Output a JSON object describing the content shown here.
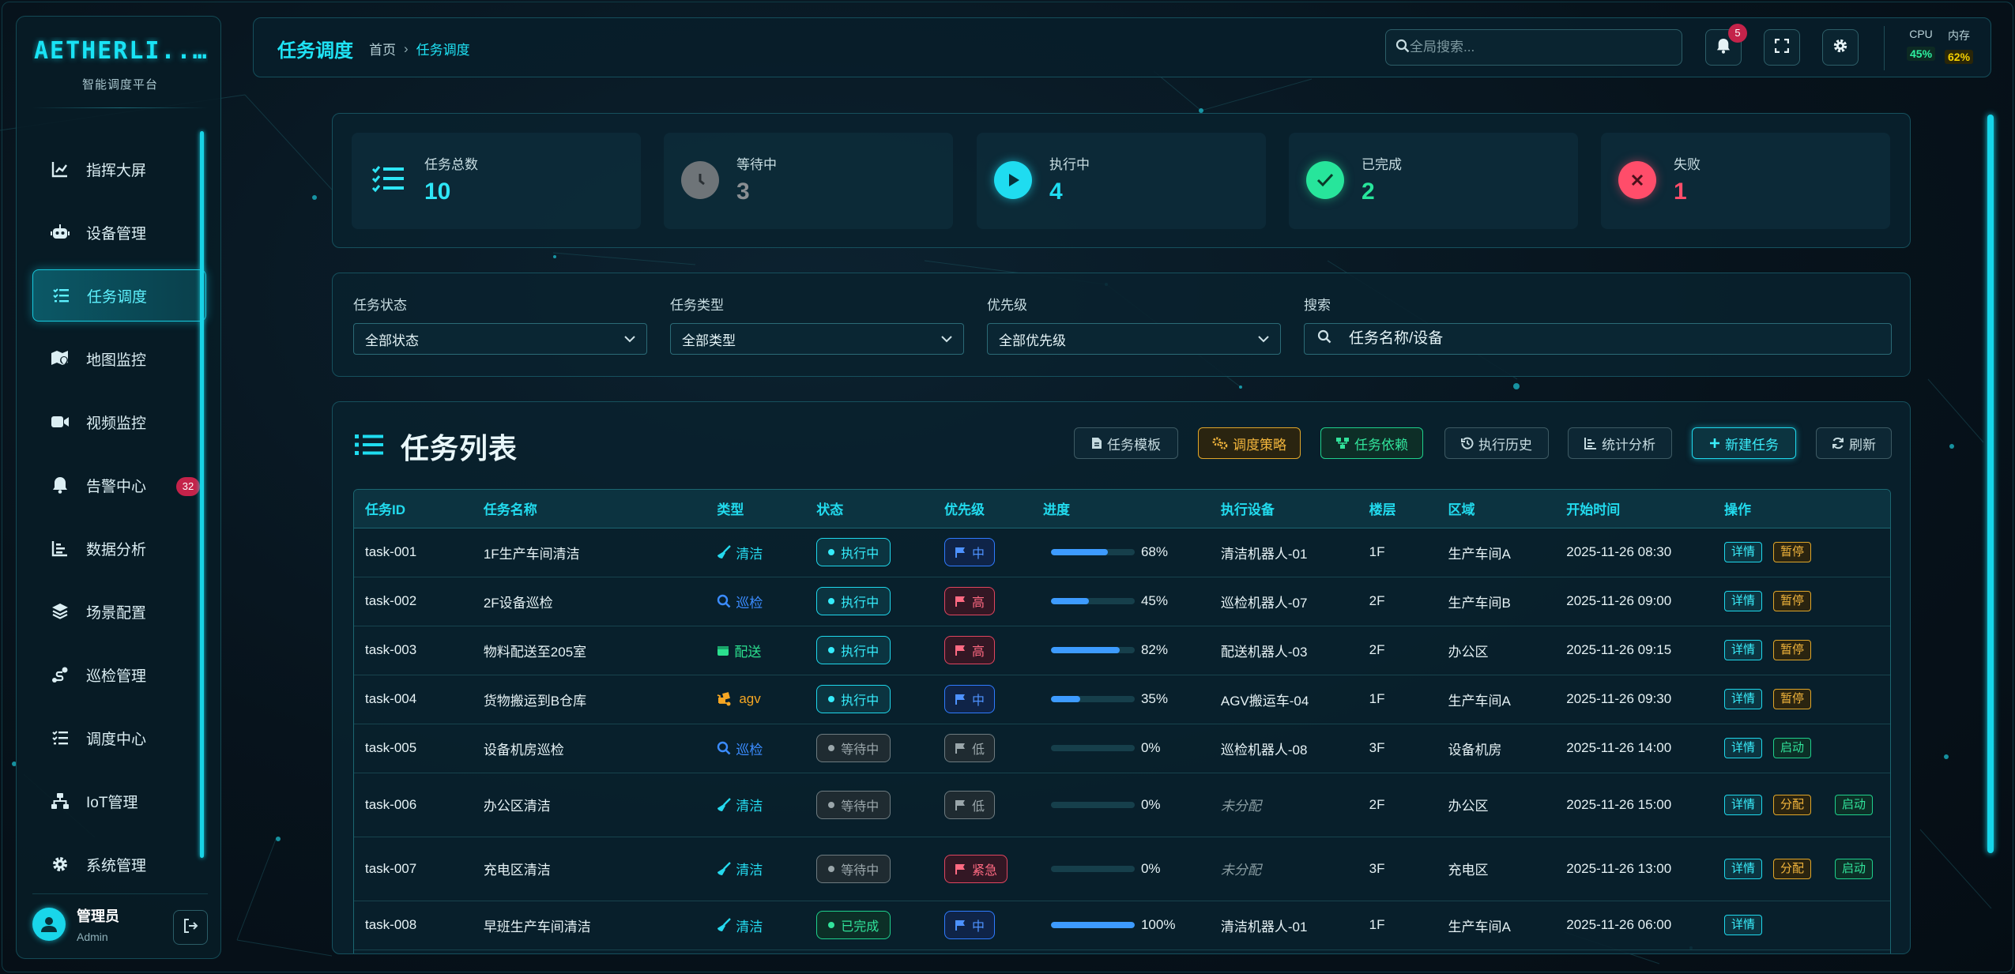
{
  "brand": {
    "logo": "AETHERLI...",
    "subtitle": "智能调度平台"
  },
  "sidebar": {
    "items": [
      {
        "label": "指挥大屏",
        "icon": "chart-line-icon"
      },
      {
        "label": "设备管理",
        "icon": "robot-icon"
      },
      {
        "label": "任务调度",
        "icon": "task-list-icon",
        "active": true
      },
      {
        "label": "地图监控",
        "icon": "map-marker-icon"
      },
      {
        "label": "视频监控",
        "icon": "video-icon"
      },
      {
        "label": "告警中心",
        "icon": "bell-icon",
        "badge": "32"
      },
      {
        "label": "数据分析",
        "icon": "bar-chart-icon"
      },
      {
        "label": "场景配置",
        "icon": "layers-icon"
      },
      {
        "label": "巡检管理",
        "icon": "route-icon"
      },
      {
        "label": "调度中心",
        "icon": "checklist-icon"
      },
      {
        "label": "IoT管理",
        "icon": "network-icon"
      },
      {
        "label": "系统管理",
        "icon": "gear-icon"
      }
    ],
    "user": {
      "name": "管理员",
      "role": "Admin"
    }
  },
  "header": {
    "title": "任务调度",
    "breadcrumb": {
      "home": "首页",
      "current": "任务调度"
    },
    "search_placeholder": "全局搜索...",
    "notification_count": "5",
    "metrics": {
      "cpu_label": "CPU",
      "cpu_value": "45%",
      "mem_label": "内存",
      "mem_value": "62%"
    }
  },
  "stats": [
    {
      "label": "任务总数",
      "value": "10",
      "color": "#2ee6f6"
    },
    {
      "label": "等待中",
      "value": "3",
      "color": "#8a8f93"
    },
    {
      "label": "执行中",
      "value": "4",
      "color": "#1fdcf0"
    },
    {
      "label": "已完成",
      "value": "2",
      "color": "#27e59b"
    },
    {
      "label": "失败",
      "value": "1",
      "color": "#ff4d6a"
    }
  ],
  "filters": {
    "status": {
      "label": "任务状态",
      "value": "全部状态"
    },
    "type": {
      "label": "任务类型",
      "value": "全部类型"
    },
    "priority": {
      "label": "优先级",
      "value": "全部优先级"
    },
    "search": {
      "label": "搜索",
      "placeholder": "任务名称/设备"
    }
  },
  "tasks": {
    "title": "任务列表",
    "toolbar": {
      "template": "任务模板",
      "strategy": "调度策略",
      "dependency": "任务依赖",
      "history": "执行历史",
      "stats": "统计分析",
      "new": "新建任务",
      "refresh": "刷新"
    },
    "columns": [
      "任务ID",
      "任务名称",
      "类型",
      "状态",
      "优先级",
      "进度",
      "执行设备",
      "楼层",
      "区域",
      "开始时间",
      "操作"
    ],
    "rows": [
      {
        "id": "task-001",
        "name": "1F生产车间清洁",
        "type": "清洁",
        "type_key": "clean",
        "status": "执行中",
        "status_key": "run",
        "priority": "中",
        "priority_key": "mid",
        "progress": 68,
        "progress_label": "68%",
        "device": "清洁机器人-01",
        "floor": "1F",
        "area": "生产车间A",
        "start": "2025-11-26 08:30",
        "actions": [
          "详情",
          "暂停"
        ]
      },
      {
        "id": "task-002",
        "name": "2F设备巡检",
        "type": "巡检",
        "type_key": "inspect",
        "status": "执行中",
        "status_key": "run",
        "priority": "高",
        "priority_key": "high",
        "progress": 45,
        "progress_label": "45%",
        "device": "巡检机器人-07",
        "floor": "2F",
        "area": "生产车间B",
        "start": "2025-11-26 09:00",
        "actions": [
          "详情",
          "暂停"
        ]
      },
      {
        "id": "task-003",
        "name": "物料配送至205室",
        "type": "配送",
        "type_key": "deliver",
        "status": "执行中",
        "status_key": "run",
        "priority": "高",
        "priority_key": "high",
        "progress": 82,
        "progress_label": "82%",
        "device": "配送机器人-03",
        "floor": "2F",
        "area": "办公区",
        "start": "2025-11-26 09:15",
        "actions": [
          "详情",
          "暂停"
        ]
      },
      {
        "id": "task-004",
        "name": "货物搬运到B仓库",
        "type": "agv",
        "type_key": "agv",
        "status": "执行中",
        "status_key": "run",
        "priority": "中",
        "priority_key": "mid",
        "progress": 35,
        "progress_label": "35%",
        "device": "AGV搬运车-04",
        "floor": "1F",
        "area": "生产车间A",
        "start": "2025-11-26 09:30",
        "actions": [
          "详情",
          "暂停"
        ]
      },
      {
        "id": "task-005",
        "name": "设备机房巡检",
        "type": "巡检",
        "type_key": "inspect",
        "status": "等待中",
        "status_key": "wait",
        "priority": "低",
        "priority_key": "low",
        "progress": 0,
        "progress_label": "0%",
        "device": "巡检机器人-08",
        "floor": "3F",
        "area": "设备机房",
        "start": "2025-11-26 14:00",
        "actions": [
          "详情",
          "启动"
        ]
      },
      {
        "id": "task-006",
        "name": "办公区清洁",
        "type": "清洁",
        "type_key": "clean",
        "status": "等待中",
        "status_key": "wait",
        "priority": "低",
        "priority_key": "low",
        "progress": 0,
        "progress_label": "0%",
        "device": "未分配",
        "unassigned": true,
        "floor": "2F",
        "area": "办公区",
        "start": "2025-11-26 15:00",
        "actions": [
          "详情",
          "分配",
          "启动"
        ]
      },
      {
        "id": "task-007",
        "name": "充电区清洁",
        "type": "清洁",
        "type_key": "clean",
        "status": "等待中",
        "status_key": "wait",
        "priority": "紧急",
        "priority_key": "urgent",
        "progress": 0,
        "progress_label": "0%",
        "device": "未分配",
        "unassigned": true,
        "floor": "3F",
        "area": "充电区",
        "start": "2025-11-26 13:00",
        "actions": [
          "详情",
          "分配",
          "启动"
        ]
      },
      {
        "id": "task-008",
        "name": "早班生产车间清洁",
        "type": "清洁",
        "type_key": "clean",
        "status": "已完成",
        "status_key": "done",
        "priority": "中",
        "priority_key": "mid",
        "progress": 100,
        "progress_label": "100%",
        "device": "清洁机器人-01",
        "floor": "1F",
        "area": "生产车间A",
        "start": "2025-11-26 06:00",
        "actions": [
          "详情"
        ]
      }
    ]
  }
}
